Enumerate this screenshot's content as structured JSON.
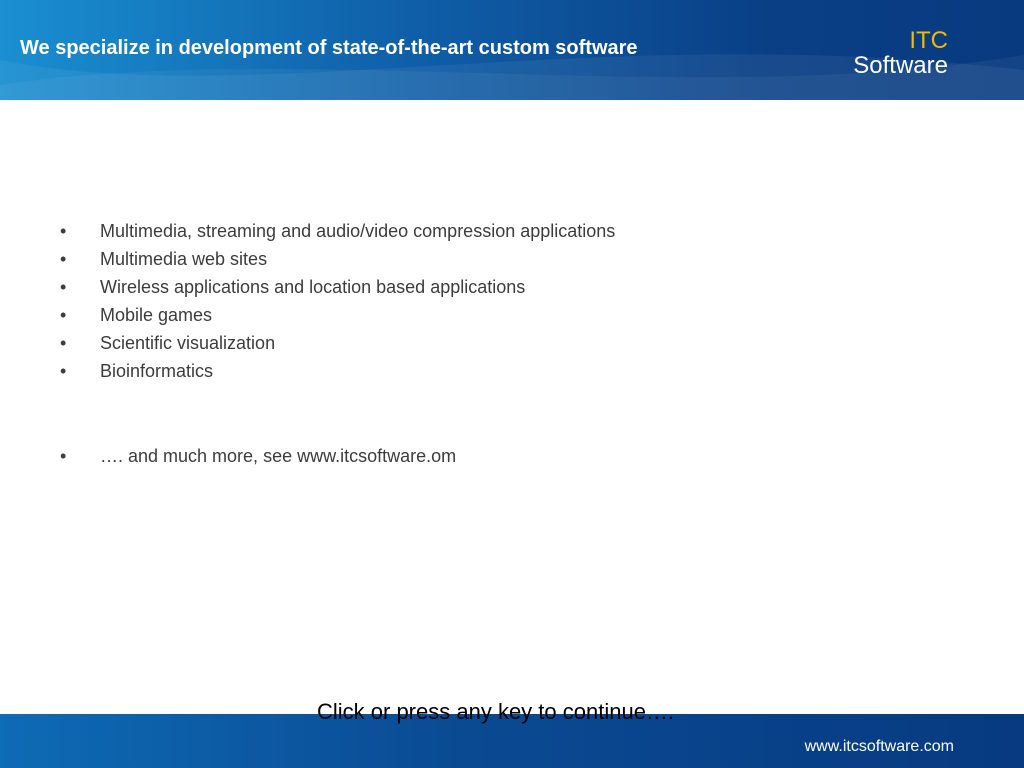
{
  "header": {
    "title": "We specialize in development of state-of-the-art custom software",
    "logo_line1": "ITC",
    "logo_line2": "Software"
  },
  "bullets": [
    "Multimedia, streaming and audio/video compression applications",
    "Multimedia web sites",
    "Wireless applications and location based applications",
    "Mobile games",
    "Scientific visualization",
    "Bioinformatics"
  ],
  "extra_bullet": "…. and much more, see www.itcsoftware.om",
  "bullet_glyph": "•",
  "continue_prompt": "Click or press any key to continue….",
  "footer": {
    "url": "www.itcsoftware.com"
  },
  "colors": {
    "header_blue": "#0f5fa8",
    "logo_accent": "#f5b800",
    "footer_blue": "#0a4a93"
  }
}
